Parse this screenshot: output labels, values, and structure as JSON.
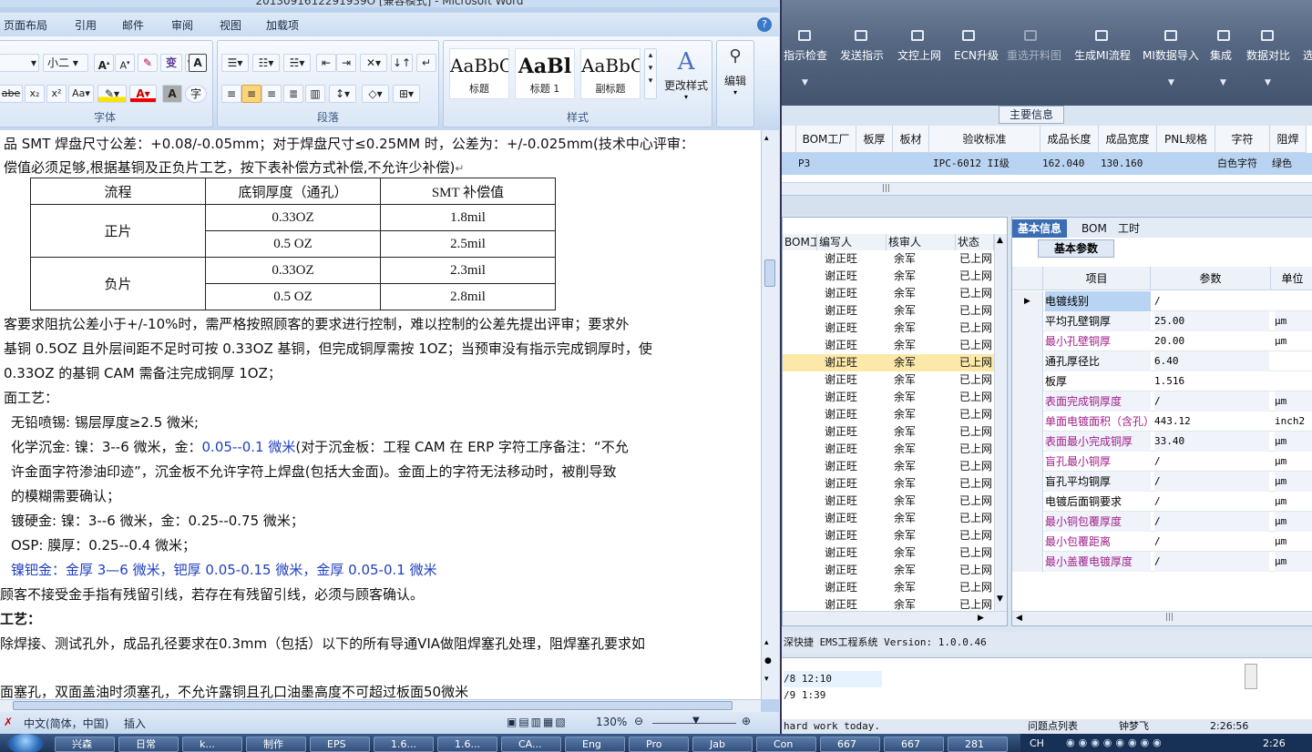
{
  "word": {
    "title": "2013091612291939O [兼容模式] - Microsoft Word",
    "tabs": [
      "页面布局",
      "引用",
      "邮件",
      "审阅",
      "视图",
      "加载项"
    ],
    "help": "?",
    "ribbon": {
      "font_size": "小二",
      "font_group": "字体",
      "para_group": "段落",
      "style_group": "样式",
      "styles": [
        {
          "preview": "AaBbC",
          "name": "标题"
        },
        {
          "preview": "AaBl",
          "name": "标题 1"
        },
        {
          "preview": "AaBbC",
          "name": "副标题"
        }
      ],
      "change_style": "更改样式",
      "edit": "编辑"
    },
    "doc": {
      "line_top": "品 SMT 焊盘尺寸公差：+0.08/-0.05mm；对于焊盘尺寸≤0.25MM 时，公差为：+/-0.025mm(技术中心评审：",
      "line_comp": "偿值必须足够,根据基铜及正负片工艺，按下表补偿方式补偿,不允许少补偿)",
      "table": {
        "headers": [
          "流程",
          "底铜厚度（通孔）",
          "SMT 补偿值"
        ],
        "groups": [
          {
            "name": "正片",
            "rows": [
              [
                "0.33OZ",
                "1.8mil"
              ],
              [
                "0.5 OZ",
                "2.5mil"
              ]
            ]
          },
          {
            "name": "负片",
            "rows": [
              [
                "0.33OZ",
                "2.3mil"
              ],
              [
                "0.5 OZ",
                "2.8mil"
              ]
            ]
          }
        ]
      },
      "lines": [
        "客要求阻抗公差小于+/-10%时，需严格按照顾客的要求进行控制，难以控制的公差先提出评审；要求外",
        "基铜 0.5OZ 且外层间距不足时可按 0.33OZ 基铜，但完成铜厚需按 1OZ；当预审没有指示完成铜厚时，使",
        " 0.33OZ 的基铜 CAM 需备注完成铜厚 1OZ；",
        "面工艺：",
        "无铅喷锡:   锡层厚度≥2.5 微米;",
        "化学沉金:   镍：3--6 微米，金：",
        "0.05--0.1 微米",
        "(对于沉金板：工程 CAM 在 ERP 字符工序备注：“不允",
        "许金面字符渗油印迹”，沉金板不允许字符上焊盘(包括大金面)。金面上的字符无法移动时，被削导致",
        "的模糊需要确认；",
        "镀硬金:       镍：3--6 微米，金：0.25--0.75 微米；",
        "OSP:           膜厚：0.25--0.4 微米；",
        "镍钯金：金厚 3—6 微米，钯厚 0.05-0.15 微米，金厚 0.05-0.1 微米",
        " 顾客不接受金手指有残留引线，若存在有残留引线，必须与顾客确认。",
        "工艺：",
        "除焊接、测试孔外，成品孔径要求在0.3mm（包括）以下的所有导通VIA做阻焊塞孔处理，阻焊塞孔要求如",
        "面塞孔，双面盖油时须塞孔，不允许露铜且孔口油墨高度不可超过板面50微米"
      ]
    },
    "status": {
      "lang": "中文(简体，中国)",
      "mode": "插入",
      "zoom": "130%"
    }
  },
  "erp": {
    "toolbar": [
      "指示检查",
      "发送指示",
      "文控上网",
      "ECN升级",
      "重选开料图",
      "生成MI流程",
      "MI数据导入",
      "集成",
      "数据对比",
      "选"
    ],
    "section": "主要信息",
    "grid1": {
      "headers": [
        "BOM工厂",
        "板厚",
        "板材",
        "验收标准",
        "成品长度",
        "成品宽度",
        "PNL规格",
        "字符",
        "阻焊"
      ],
      "row": [
        "P3",
        "",
        "",
        "IPC-6012 II级",
        "162.040",
        "130.160",
        "",
        "白色字符",
        "绿色"
      ]
    },
    "leftgrid": {
      "headers": [
        "BOM工厂",
        "编写人",
        "核审人",
        "状态"
      ],
      "rows": [
        [
          "谢正旺",
          "余军",
          "已上网"
        ],
        [
          "谢正旺",
          "余军",
          "已上网"
        ],
        [
          "谢正旺",
          "余军",
          "已上网"
        ],
        [
          "谢正旺",
          "余军",
          "已上网"
        ],
        [
          "谢正旺",
          "余军",
          "已上网"
        ],
        [
          "谢正旺",
          "余军",
          "已上网"
        ],
        [
          "谢正旺",
          "余军",
          "已上网"
        ],
        [
          "谢正旺",
          "余军",
          "已上网"
        ],
        [
          "谢正旺",
          "余军",
          "已上网"
        ],
        [
          "谢正旺",
          "余军",
          "已上网"
        ],
        [
          "谢正旺",
          "余军",
          "已上网"
        ],
        [
          "谢正旺",
          "余军",
          "已上网"
        ],
        [
          "谢正旺",
          "余军",
          "已上网"
        ],
        [
          "谢正旺",
          "余军",
          "已上网"
        ],
        [
          "谢正旺",
          "余军",
          "已上网"
        ],
        [
          "谢正旺",
          "余军",
          "已上网"
        ],
        [
          "谢正旺",
          "余军",
          "已上网"
        ],
        [
          "谢正旺",
          "余军",
          "已上网"
        ],
        [
          "谢正旺",
          "余军",
          "已上网"
        ],
        [
          "谢正旺",
          "余军",
          "已上网"
        ],
        [
          "谢正旺",
          "余军",
          "已上网"
        ],
        [
          "谢正旺",
          "余军",
          "已上网"
        ]
      ]
    },
    "rpanel": {
      "tabs": [
        "基本信息",
        "BOM",
        "工时"
      ],
      "subtab": "基本参数",
      "headers": [
        "项目",
        "参数",
        "单位"
      ],
      "rows": [
        [
          "电镀线别",
          "/",
          ""
        ],
        [
          "平均孔壁铜厚",
          "25.00",
          "μm"
        ],
        [
          "最小孔壁铜厚",
          "20.00",
          "μm"
        ],
        [
          "通孔厚径比",
          "6.40",
          ""
        ],
        [
          "板厚",
          "1.516",
          ""
        ],
        [
          "表面完成铜厚度",
          "/",
          "μm"
        ],
        [
          "单面电镀面积（含孔）",
          "443.12",
          "inch2"
        ],
        [
          "表面最小完成铜厚",
          "33.40",
          "μm"
        ],
        [
          "盲孔最小铜厚",
          "/",
          "μm"
        ],
        [
          "盲孔平均铜厚",
          "/",
          "μm"
        ],
        [
          "电镀后面铜要求",
          "/",
          "μm"
        ],
        [
          "最小铜包覆厚度",
          "/",
          "μm"
        ],
        [
          "最小包覆距离",
          "/",
          "μm"
        ],
        [
          "最小盖覆电镀厚度",
          "/",
          "μm"
        ]
      ]
    },
    "version": "深快捷 EMS工程系统 Version: 1.0.0.46",
    "log": [
      "/8 12:10",
      "/9 1:39"
    ],
    "status": {
      "msg": "hard work today.",
      "issues": "问题点列表",
      "user": "钟梦飞",
      "time": "2:26:56"
    }
  },
  "taskbar": [
    "兴森",
    "日常",
    "k...",
    "制作",
    "EPS",
    "1.6...",
    "1.6...",
    "CA...",
    "Eng",
    "Pro",
    "Jab",
    "Con",
    "667",
    "667",
    "281"
  ],
  "tray_time": "2:26"
}
